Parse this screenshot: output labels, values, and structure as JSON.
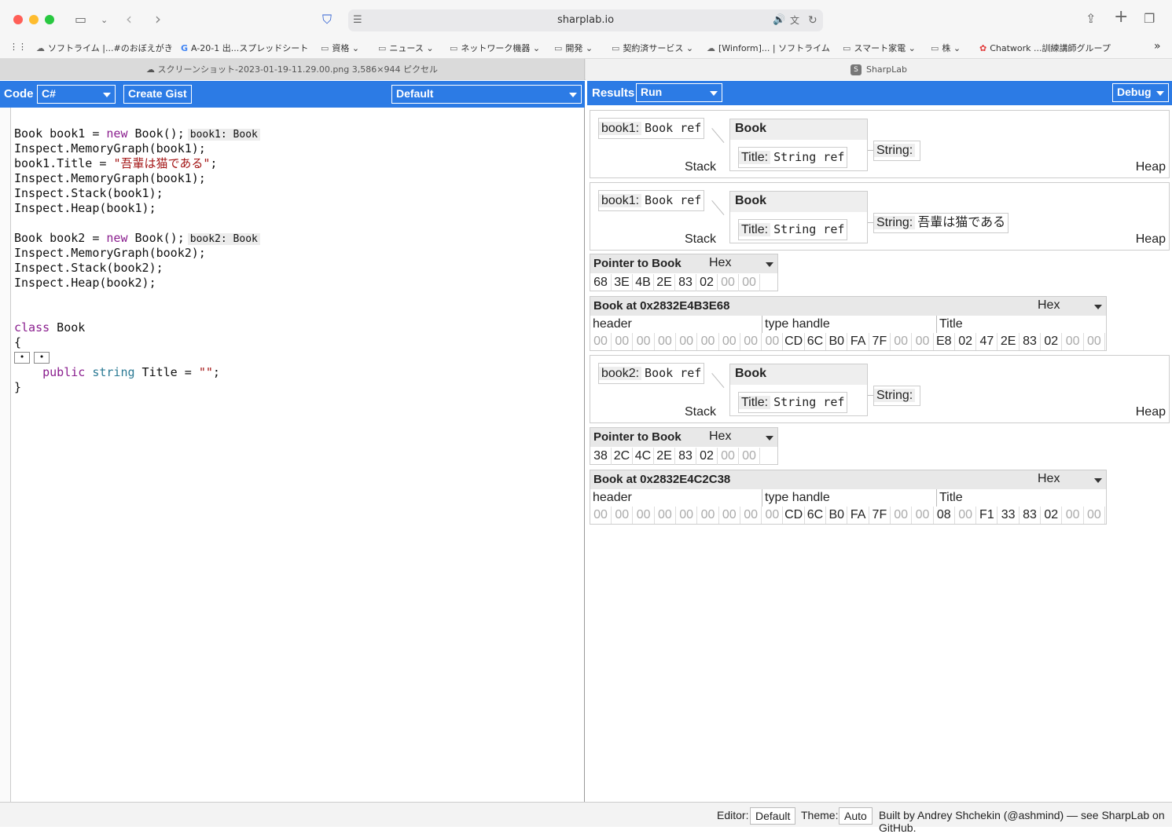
{
  "browser": {
    "url": "sharplab.io",
    "bookmarks": [
      "ソフトライム |...#のおぼえがき",
      "A-20-1 出...スプレッドシート",
      "資格",
      "ニュース",
      "ネットワーク機器",
      "開発",
      "契約済サービス",
      "[Winform]... | ソフトライム",
      "スマート家電",
      "株",
      "Chatwork ...訓練講師グループ"
    ],
    "tabs": [
      "スクリーンショット-2023-01-19-11.29.00.png 3,586×944 ピクセル",
      "SharpLab"
    ]
  },
  "toolbar_left": {
    "code_label": "Code",
    "language": "C#",
    "create_gist": "Create Gist",
    "branch": "Default"
  },
  "toolbar_right": {
    "results_label": "Results",
    "mode": "Run",
    "config": "Debug"
  },
  "code": {
    "lines": [
      [
        {
          "t": "Book book1 = "
        },
        {
          "t": "new",
          "c": "kw"
        },
        {
          "t": " Book();"
        },
        {
          "t": "book1: Book",
          "c": "hint"
        }
      ],
      [
        {
          "t": "Inspect.MemoryGraph(book1);"
        }
      ],
      [
        {
          "t": "book1.Title = "
        },
        {
          "t": "\"吾輩は猫である\"",
          "c": "str"
        },
        {
          "t": ";"
        }
      ],
      [
        {
          "t": "Inspect.MemoryGraph(book1);"
        }
      ],
      [
        {
          "t": "Inspect.Stack(book1);"
        }
      ],
      [
        {
          "t": "Inspect.Heap(book1);"
        }
      ],
      [],
      [
        {
          "t": "Book book2 = "
        },
        {
          "t": "new",
          "c": "kw"
        },
        {
          "t": " Book();"
        },
        {
          "t": "book2: Book",
          "c": "hint"
        }
      ],
      [
        {
          "t": "Inspect.MemoryGraph(book2);"
        }
      ],
      [
        {
          "t": "Inspect.Stack(book2);"
        }
      ],
      [
        {
          "t": "Inspect.Heap(book2);"
        }
      ],
      [],
      [],
      [
        {
          "t": "class",
          "c": "kw"
        },
        {
          "t": " Book"
        }
      ],
      [
        {
          "t": "{"
        }
      ],
      [
        {
          "t": "•",
          "c": "fold"
        },
        {
          "t": "•",
          "c": "fold"
        }
      ],
      [
        {
          "t": "    "
        },
        {
          "t": "public",
          "c": "kw"
        },
        {
          "t": " "
        },
        {
          "t": "string",
          "c": "ty"
        },
        {
          "t": " Title = "
        },
        {
          "t": "\"\"",
          "c": "str"
        },
        {
          "t": ";"
        }
      ],
      [
        {
          "t": "}"
        }
      ]
    ]
  },
  "graphs": [
    {
      "var": "book1:",
      "var_type": "Book ref",
      "stack": "Stack",
      "heap": "Heap",
      "obj": "Book",
      "field": "Title:",
      "field_type": "String ref",
      "string_label": "String:",
      "string_value": ""
    },
    {
      "var": "book1:",
      "var_type": "Book ref",
      "stack": "Stack",
      "heap": "Heap",
      "obj": "Book",
      "field": "Title:",
      "field_type": "String ref",
      "string_label": "String:",
      "string_value": "吾輩は猫である"
    },
    {
      "var": "book2:",
      "var_type": "Book ref",
      "stack": "Stack",
      "heap": "Heap",
      "obj": "Book",
      "field": "Title:",
      "field_type": "String ref",
      "string_label": "String:",
      "string_value": ""
    }
  ],
  "pointers": [
    {
      "title": "Pointer to Book",
      "format": "Hex",
      "bytes": [
        "68",
        "3E",
        "4B",
        "2E",
        "83",
        "02",
        "00",
        "00"
      ]
    },
    {
      "title": "Pointer to Book",
      "format": "Hex",
      "bytes": [
        "38",
        "2C",
        "4C",
        "2E",
        "83",
        "02",
        "00",
        "00"
      ]
    }
  ],
  "heaps": [
    {
      "title": "Book at 0x2832E4B3E68",
      "format": "Hex",
      "fields": [
        "header",
        "type handle",
        "Title"
      ],
      "bytes": [
        "00",
        "00",
        "00",
        "00",
        "00",
        "00",
        "00",
        "00",
        "00",
        "CD",
        "6C",
        "B0",
        "FA",
        "7F",
        "00",
        "00",
        "E8",
        "02",
        "47",
        "2E",
        "83",
        "02",
        "00",
        "00"
      ]
    },
    {
      "title": "Book at 0x2832E4C2C38",
      "format": "Hex",
      "fields": [
        "header",
        "type handle",
        "Title"
      ],
      "bytes": [
        "00",
        "00",
        "00",
        "00",
        "00",
        "00",
        "00",
        "00",
        "00",
        "CD",
        "6C",
        "B0",
        "FA",
        "7F",
        "00",
        "00",
        "08",
        "00",
        "F1",
        "33",
        "83",
        "02",
        "00",
        "00"
      ]
    }
  ],
  "footer": {
    "editor_label": "Editor:",
    "editor_value": "Default",
    "theme_label": "Theme:",
    "theme_value": "Auto",
    "credit": "Built by Andrey Shchekin (@ashmind) — see SharpLab on GitHub."
  }
}
